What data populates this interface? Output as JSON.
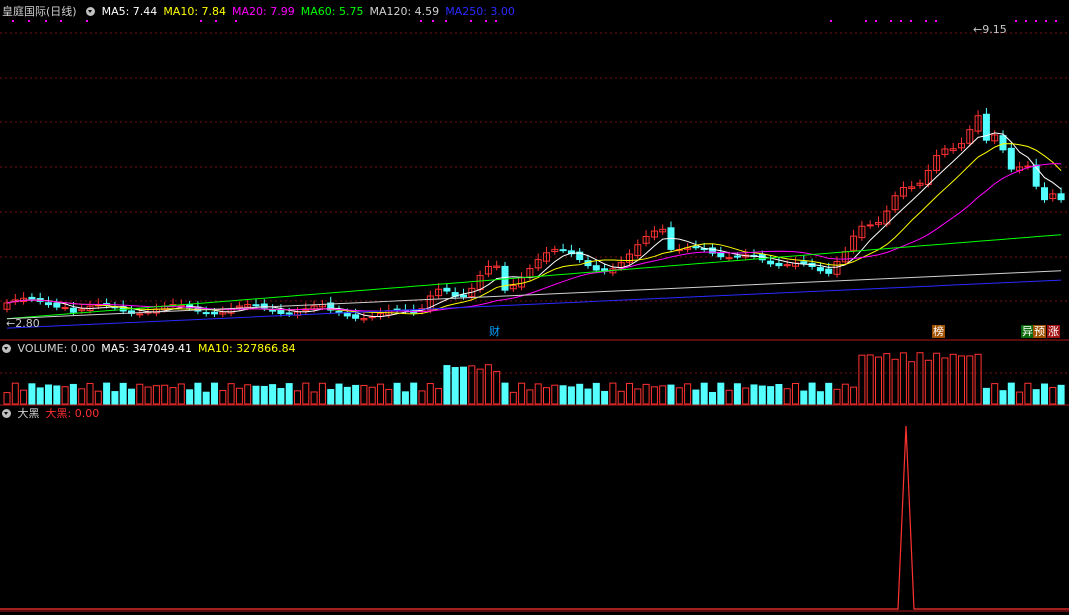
{
  "stock": {
    "name": "皇庭国际",
    "period": "(日线)"
  },
  "ma_legend": [
    {
      "label": "MA5: 7.44",
      "color": "#ffffff"
    },
    {
      "label": "MA10: 7.84",
      "color": "#ffff00"
    },
    {
      "label": "MA20: 7.99",
      "color": "#ff00ff"
    },
    {
      "label": "MA60: 5.75",
      "color": "#00ff00"
    },
    {
      "label": "MA120: 4.59",
      "color": "#d0d0d0"
    },
    {
      "label": "MA250: 3.00",
      "color": "#2a2aff"
    }
  ],
  "volume_legend": [
    {
      "label": "VOLUME: 0.00",
      "color": "#d0d0d0"
    },
    {
      "label": "MA5: 347049.41",
      "color": "#ffffff"
    },
    {
      "label": "MA10: 327866.84",
      "color": "#ffff00"
    }
  ],
  "indicator_legend": [
    {
      "label": "大黑",
      "color": "#d0d0d0"
    },
    {
      "label": "大黑: 0.00",
      "color": "#ff3030"
    }
  ],
  "price_labels": {
    "high": "9.15",
    "low": "2.80"
  },
  "event_tags": [
    {
      "text": "财",
      "bg": "#000000",
      "fg": "#00a0ff"
    },
    {
      "text": "榜",
      "bg": "#a05000",
      "fg": "#ffffff"
    },
    {
      "text": "异",
      "bg": "#0a6a0a",
      "fg": "#ffffff"
    },
    {
      "text": "预",
      "bg": "#a05000",
      "fg": "#ffffff"
    },
    {
      "text": "涨",
      "bg": "#a01010",
      "fg": "#ffffff"
    }
  ],
  "colors": {
    "up": "#ff3232",
    "down": "#54ffff",
    "grid": "#7a1010",
    "border": "#b01818"
  }
}
